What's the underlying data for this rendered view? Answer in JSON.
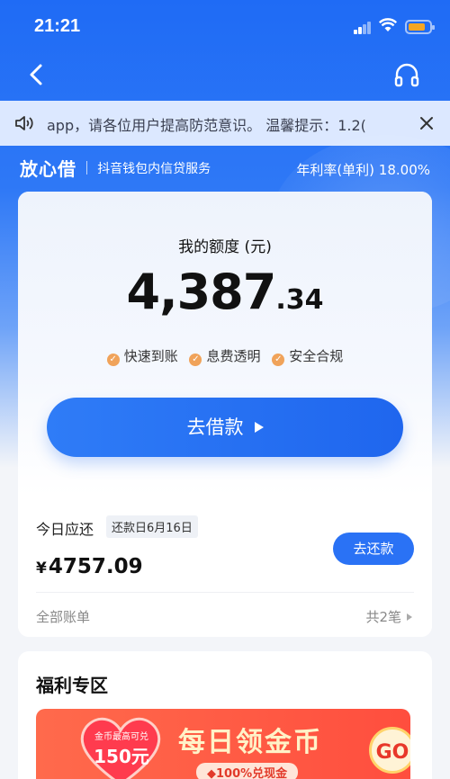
{
  "status_bar": {
    "time": "21:21"
  },
  "notice": {
    "text": "app，请各位用户提高防范意识。   温馨提示：1.2("
  },
  "brand": {
    "logo": "放心借",
    "subtitle": "抖音钱包内信贷服务",
    "rate": "年利率(单利) 18.00%"
  },
  "quota": {
    "label": "我的额度 (元)",
    "integer": "4,387",
    "decimal": ".34"
  },
  "features": [
    "快速到账",
    "息费透明",
    "安全合规"
  ],
  "borrow_button": "去借款",
  "repayment": {
    "label": "今日应还",
    "due_tag": "还款日6月16日",
    "currency": "¥",
    "amount": "4757.09",
    "button": "去还款",
    "all_bills": "全部账单",
    "count": "共2笔"
  },
  "welfare": {
    "title": "福利专区",
    "banner": {
      "badge_line1": "金币最高可兑",
      "badge_line2": "150元",
      "title": "每日领金币",
      "subtitle": "◆100%兑现金",
      "go": "GO"
    }
  }
}
